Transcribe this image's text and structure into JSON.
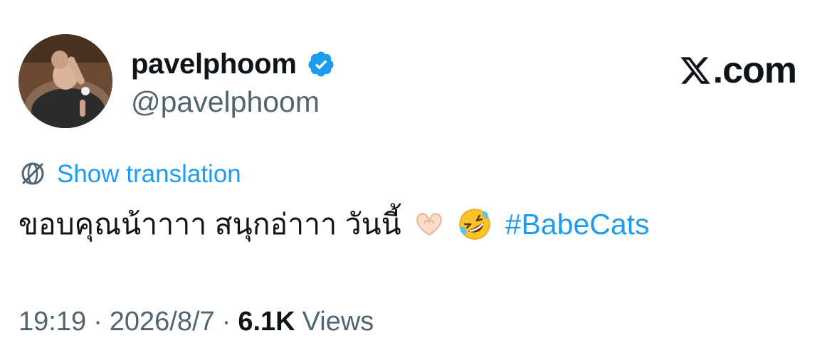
{
  "author": {
    "display_name": "pavelphoom",
    "handle": "@pavelphoom",
    "verified": true,
    "avatar_icon": "profile-photo"
  },
  "site": {
    "logo_icon": "x-logo-icon",
    "name": ".com"
  },
  "translation": {
    "icon": "globe-icon",
    "label": "Show translation"
  },
  "tweet": {
    "text": "ขอบคุณน้าาาา สนุกอ่าาา วันนี้",
    "emojis": [
      "heart-hands-emoji",
      "rolling-on-floor-laughing-emoji"
    ],
    "hashtag": "#BabeCats"
  },
  "meta": {
    "time": "19:19",
    "separator": "·",
    "date": "2026/8/7",
    "views_count": "6.1K",
    "views_label": "Views"
  },
  "colors": {
    "link": "#1d9bf0",
    "verified_badge": "#1d9bf0",
    "text": "#0f1419",
    "secondary_text": "#536471"
  }
}
